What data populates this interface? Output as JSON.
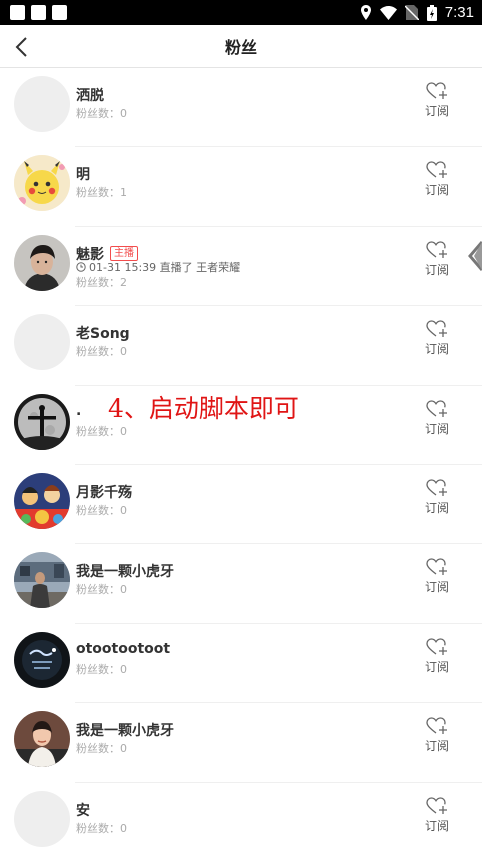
{
  "status_bar": {
    "time": "7:31"
  },
  "header": {
    "title": "粉丝"
  },
  "subscribe_label": "订阅",
  "fans": [
    {
      "name": "洒脱",
      "fans_text": "粉丝数：0",
      "avatar": "blank"
    },
    {
      "name": "明",
      "fans_text": "粉丝数：1",
      "avatar": "pikachu"
    },
    {
      "name": "魅影",
      "tag": "主播",
      "live": "01-31 15:39 直播了 王者荣耀",
      "fans_text": "粉丝数：2",
      "avatar": "person"
    },
    {
      "name": "老Song",
      "fans_text": "粉丝数：0",
      "avatar": "blank"
    },
    {
      "name": ".",
      "fans_text": "粉丝数：0",
      "avatar": "moon"
    },
    {
      "name": "月影千殇",
      "fans_text": "粉丝数：0",
      "avatar": "cartoon"
    },
    {
      "name": "我是一颗小虎牙",
      "fans_text": "粉丝数：0",
      "avatar": "street"
    },
    {
      "name": "otootootoot",
      "fans_text": "粉丝数：0",
      "avatar": "dark"
    },
    {
      "name": "我是一颗小虎牙",
      "fans_text": "粉丝数：0",
      "avatar": "girl"
    },
    {
      "name": "安",
      "fans_text": "粉丝数：0",
      "avatar": "blank"
    }
  ],
  "overlay_text": "4、启动脚本即可",
  "colors": {
    "accent": "#f24d4d",
    "overlay": "#e01515"
  }
}
